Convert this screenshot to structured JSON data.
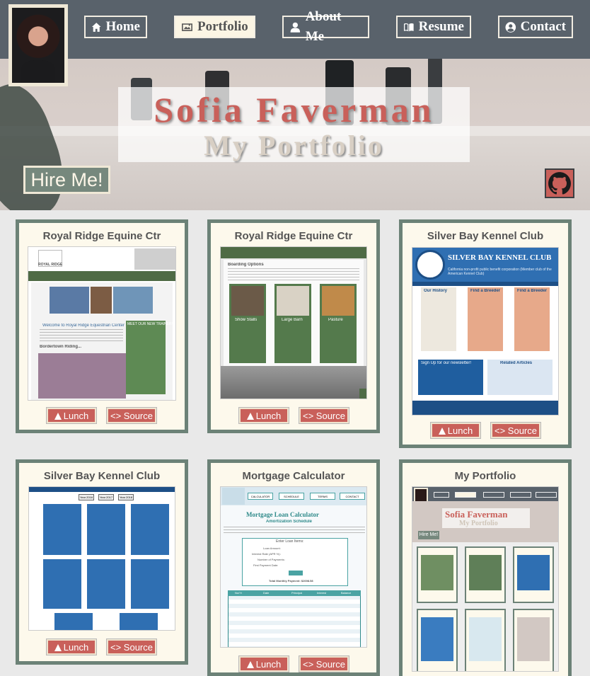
{
  "nav": {
    "items": [
      {
        "label": "Home",
        "icon": "home-icon"
      },
      {
        "label": "Portfolio",
        "icon": "image-icon"
      },
      {
        "label": "About Me",
        "icon": "user-icon"
      },
      {
        "label": "Resume",
        "icon": "book-icon"
      },
      {
        "label": "Contact",
        "icon": "user-circle-icon"
      }
    ],
    "active": "Portfolio"
  },
  "hero": {
    "name": "Sofia Faverman",
    "subtitle": "My Portfolio",
    "hire_label": "Hire Me!"
  },
  "colors": {
    "navbar": "#59626b",
    "accent": "#c9605a",
    "card_border": "#6c8277",
    "card_bg": "#fdf9ec"
  },
  "cards": [
    {
      "title": "Royal Ridge Equine Ctr",
      "lunch": "Lunch",
      "source": "Source"
    },
    {
      "title": "Royal Ridge Equine Ctr",
      "lunch": "Lunch",
      "source": "Source"
    },
    {
      "title": "Silver Bay Kennel Club",
      "lunch": "Lunch",
      "source": "Source"
    },
    {
      "title": "Silver Bay Kennel Club",
      "lunch": "Lunch",
      "source": "Source"
    },
    {
      "title": "Mortgage Calculator",
      "lunch": "Lunch",
      "source": "Source"
    },
    {
      "title": "My Portfolio",
      "lunch": "Lunch",
      "source": "Source"
    }
  ],
  "thumbs": {
    "rr1": {
      "brand": "ROYAL RIDGE",
      "welcome": "Welcome to Royal Ridge Equestrian Center",
      "trainer": "MEET OUR NEW TRAINER!",
      "section": "Bordertown Riding..."
    },
    "rr2": {
      "section": "Boarding Options",
      "cols": [
        "Show Stalls",
        "Large Barn",
        "Pasture"
      ],
      "more": "Read more"
    },
    "sb1": {
      "banner": "SILVER BAY KENNEL CLUB",
      "tagline": "California non-profit public benefit corporation (Member club of the American Kennel Club)",
      "boxes": [
        "Our History",
        "Find a Breeder",
        "Find a Breeder"
      ],
      "signup": "Sign Up for our newsletter!",
      "related": "Related Articles"
    },
    "sb2": {
      "tabs": [
        "Year 2016",
        "Year 2017",
        "Year 2018"
      ]
    },
    "mc": {
      "nav": [
        "CALCULATOR",
        "SCHEDULE",
        "TERMS",
        "CONTACT"
      ],
      "title": "Mortgage Loan Calculator",
      "subtitle": "Amortization Schedule",
      "form_title": "Enter Loan Items:",
      "fields": [
        "Loan Amount:",
        "Interest Rate (APR %):",
        "Number of Payments:",
        "First Payment Date:"
      ],
      "payment": "Total Monthly Payment: $2698.58",
      "headers": [
        "No/Yr",
        "Date",
        "Principal",
        "Interest",
        "Balance"
      ]
    },
    "mp": {
      "name": "Sofia Faverman",
      "subtitle": "My Portfolio",
      "hire": "Hire Me!"
    }
  }
}
